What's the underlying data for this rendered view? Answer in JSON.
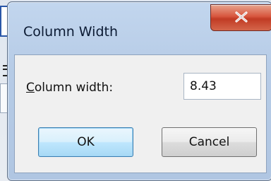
{
  "dialog": {
    "title": "Column Width",
    "close_label": "X",
    "label": "Column width:",
    "label_mnemonic": "C",
    "label_rest": "olumn width:",
    "value": "8.43",
    "ok_label": "OK",
    "cancel_label": "Cancel"
  },
  "colors": {
    "titlebar": "#b6cbe6",
    "close_button": "#d7563e",
    "client_bg": "#f0f0f0",
    "ok_border": "#3c7fb1"
  },
  "icons": {
    "close": "close-icon"
  }
}
